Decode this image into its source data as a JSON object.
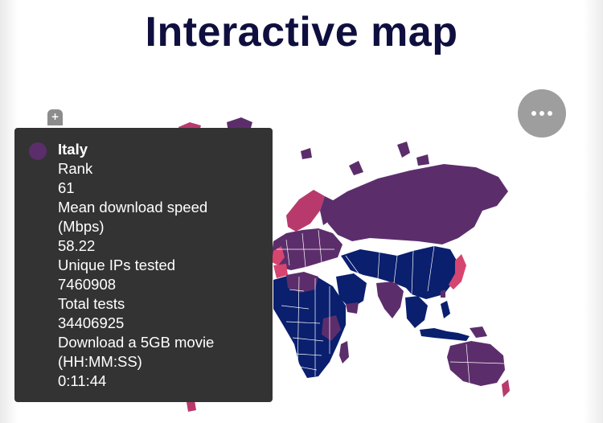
{
  "title": "Interactive map",
  "zoom": {
    "plus_label": "+"
  },
  "menu": {
    "icon": "ellipsis-icon"
  },
  "colors": {
    "purple": "#5c2d6b",
    "navy": "#0a1f6e",
    "magenta": "#b83a6c",
    "pink": "#d6456f",
    "tooltip_bg": "#333333",
    "title": "#0f0f3f"
  },
  "tooltip": {
    "country": "Italy",
    "swatch_color": "#5c2d6b",
    "rank_label": "Rank",
    "rank_value": "61",
    "download_label_1": "Mean download speed",
    "download_label_2": "(Mbps)",
    "download_value": "58.22",
    "ips_label": "Unique IPs tested",
    "ips_value": "7460908",
    "tests_label": "Total tests",
    "tests_value": "34406925",
    "movie_label_1": "Download a 5GB movie",
    "movie_label_2": "(HH:MM:SS)",
    "movie_value": "0:11:44"
  }
}
